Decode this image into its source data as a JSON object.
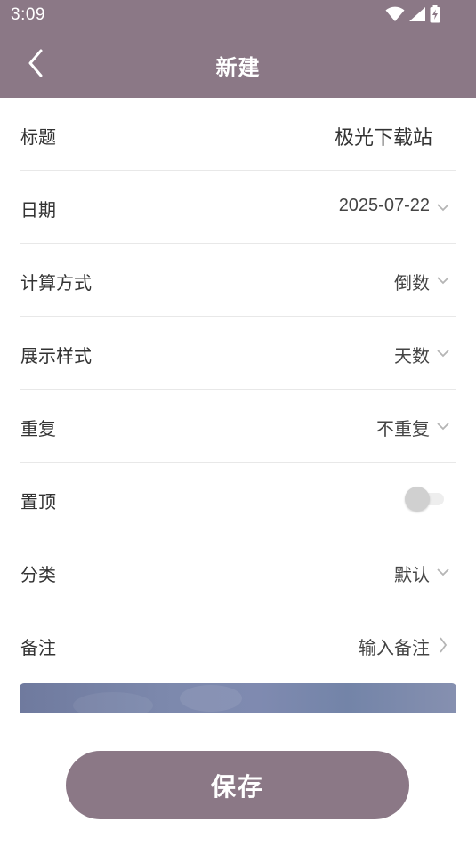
{
  "status_bar": {
    "time": "3:09"
  },
  "header": {
    "title": "新建"
  },
  "form": {
    "rows": [
      {
        "label": "标题",
        "value": "极光下载站"
      },
      {
        "label": "日期",
        "value": "2025-07-22"
      },
      {
        "label": "计算方式",
        "value": "倒数"
      },
      {
        "label": "展示样式",
        "value": "天数"
      },
      {
        "label": "重复",
        "value": "不重复"
      },
      {
        "label": "置顶",
        "toggle_on": false
      },
      {
        "label": "分类",
        "value": "默认"
      },
      {
        "label": "备注",
        "value": "输入备注"
      }
    ]
  },
  "save_label": "保存",
  "colors": {
    "accent": "#8b7886",
    "divider": "#e8e8e8",
    "text": "#333333"
  }
}
